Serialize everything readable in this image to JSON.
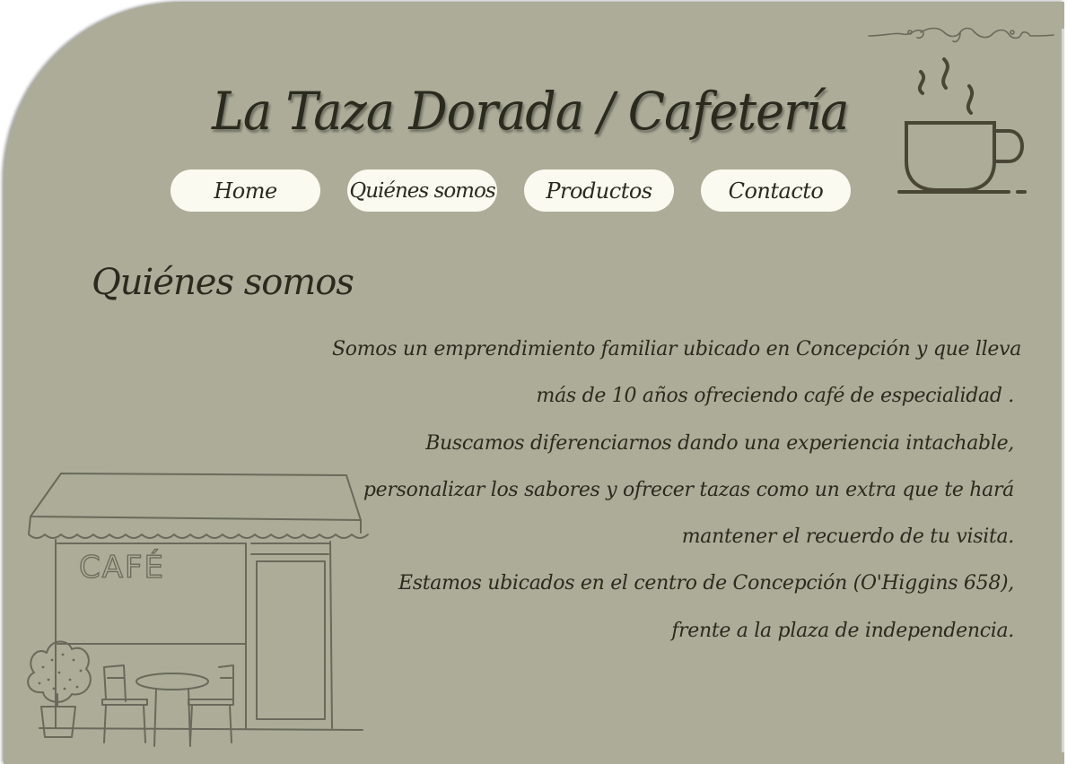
{
  "header": {
    "title": "La Taza Dorada / Cafetería"
  },
  "nav": {
    "items": [
      {
        "label": "Home"
      },
      {
        "label": "Quiénes somos"
      },
      {
        "label": "Productos"
      },
      {
        "label": "Contacto"
      }
    ]
  },
  "about": {
    "heading": "Quiénes somos",
    "lines": [
      "Somos un emprendimiento familiar ubicado en Concepción y que lleva",
      "más de 10 años ofreciendo café de especialidad .",
      "Buscamos diferenciarnos dando una experiencia intachable,",
      "personalizar los sabores y ofrecer tazas como un extra que te hará",
      "mantener el recuerdo de tu visita.",
      "Estamos ubicados en el centro de Concepción (O'Higgins 658),",
      "frente a la plaza de independencia."
    ]
  },
  "illustration": {
    "sign_text": "CAFÉ"
  },
  "icons": [
    "ornament-flourish-icon",
    "coffee-cup-icon",
    "cafe-storefront-illustration"
  ],
  "colors": {
    "background": "#acac98",
    "nav_button": "#fbfaf0",
    "text": "#2a2a1e",
    "sketch_line": "#6a6a5c",
    "cup_line": "#4a4636"
  }
}
